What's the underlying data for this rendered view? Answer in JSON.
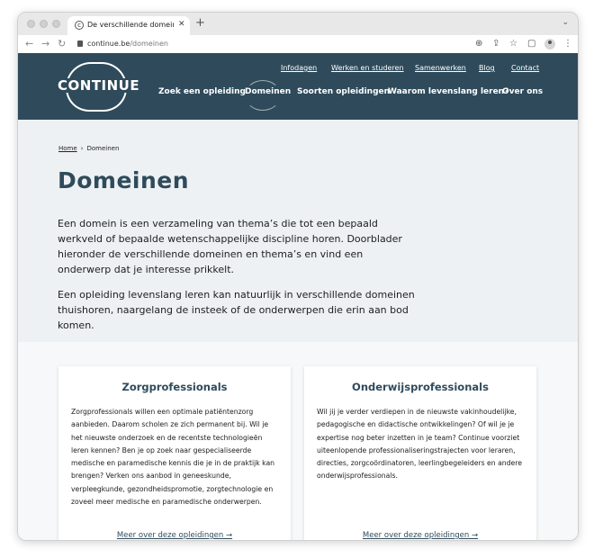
{
  "browser": {
    "tab_title": "De verschillende domeinen van",
    "url_domain": "continue.be",
    "url_path": "/domeinen"
  },
  "site": {
    "logo_text": "CONTINUE",
    "utility_nav": [
      "Infodagen",
      "Werken en studeren",
      "Samenwerken",
      "Blog",
      "Contact"
    ],
    "main_nav": [
      "Zoek een opleiding",
      "Domeinen",
      "Soorten opleidingen",
      "Waarom levenslang leren?",
      "Over ons"
    ],
    "active_nav": "Domeinen"
  },
  "colors": {
    "brand": "#2f4b5b",
    "hero_bg": "#eef1f3"
  },
  "breadcrumb": {
    "home": "Home",
    "separator": "›",
    "current": "Domeinen"
  },
  "page": {
    "title": "Domeinen",
    "intro_1": "Een domein is een verzameling van thema’s die tot een bepaald werkveld of bepaalde wetenschappelijke discipline horen. Doorblader hieronder de verschillende domeinen en thema’s en vind een onderwerp dat je interesse prikkelt.",
    "intro_2": "Een opleiding levenslang leren kan natuurlijk in verschillende domeinen thuishoren, naargelang de insteek of de onderwerpen die erin aan bod komen."
  },
  "cards": [
    {
      "title": "Zorgprofessionals",
      "body": "Zorgprofessionals willen een optimale patiëntenzorg aanbieden. Daarom scholen ze zich permanent bij. Wil je het nieuwste onderzoek en de recentste technologieën leren kennen? Ben je op zoek naar gespecialiseerde medische en paramedische kennis die je in de praktijk kan brengen? Verken ons aanbod in geneeskunde, verpleegkunde, gezondheidspromotie, zorgtechnologie en zoveel meer medische en paramedische onderwerpen.",
      "link": "Meer over deze opleidingen →"
    },
    {
      "title": "Onderwijsprofessionals",
      "body": "Wil jij je verder verdiepen in de nieuwste vakinhoudelijke, pedagogische en didactische ontwikkelingen? Of wil je je expertise nog beter inzetten in je team? Continue voorziet uiteenlopende professionaliseringstrajecten voor leraren, directies, zorgcoördinatoren, leerlingbegeleiders en andere onderwijsprofessionals.",
      "link": "Meer over deze opleidingen →"
    }
  ]
}
